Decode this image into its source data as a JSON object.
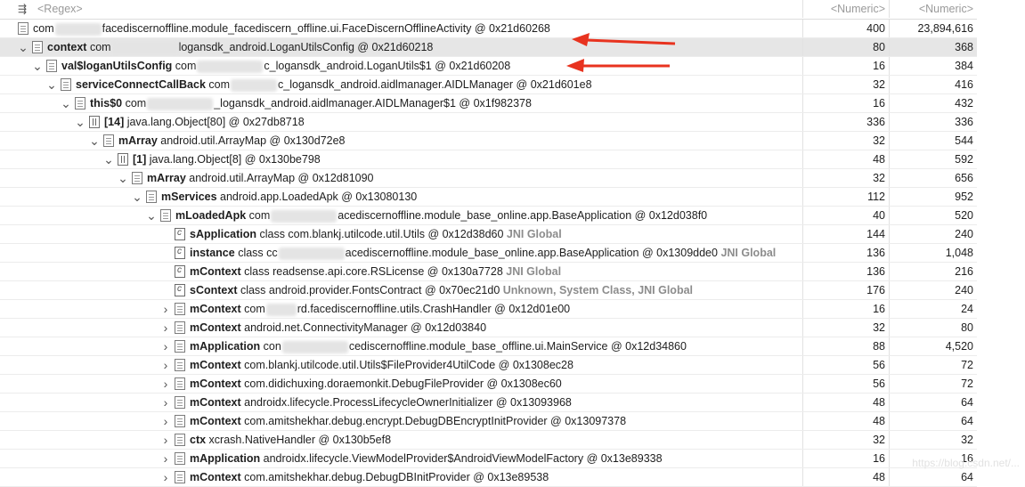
{
  "header": {
    "regex_placeholder": "<Regex>",
    "col1": "<Numeric>",
    "col2": "<Numeric>"
  },
  "rows": [
    {
      "depth": 0,
      "toggle": "",
      "icon": "obj",
      "field": "",
      "pre": "com",
      "blur": "m",
      "post": "facediscernoffline.module_facediscern_offline.ui.FaceDiscernOfflineActivity @ 0x21d60268",
      "gc": "",
      "v1": "400",
      "v2": "23,894,616"
    },
    {
      "depth": 1,
      "toggle": "v",
      "icon": "obj",
      "field": "context",
      "pre": "com",
      "blur": "l",
      "post": "logansdk_android.LoganUtilsConfig @ 0x21d60218",
      "gc": "",
      "v1": "80",
      "v2": "368",
      "selected": true
    },
    {
      "depth": 2,
      "toggle": "v",
      "icon": "obj",
      "field": "val$loganUtilsConfig",
      "pre": "com",
      "blur": "l",
      "post": "c_logansdk_android.LoganUtils$1 @ 0x21d60208",
      "gc": "",
      "v1": "16",
      "v2": "384"
    },
    {
      "depth": 3,
      "toggle": "v",
      "icon": "obj",
      "field": "serviceConnectCallBack",
      "pre": "com",
      "blur": "m",
      "post": "c_logansdk_android.aidlmanager.AIDLManager @ 0x21d601e8",
      "gc": "",
      "v1": "32",
      "v2": "416"
    },
    {
      "depth": 4,
      "toggle": "v",
      "icon": "obj",
      "field": "this$0",
      "pre": "com",
      "blur": "l",
      "post": "_logansdk_android.aidlmanager.AIDLManager$1 @ 0x1f982378",
      "gc": "",
      "v1": "16",
      "v2": "432"
    },
    {
      "depth": 5,
      "toggle": "v",
      "icon": "arr",
      "field": "[14]",
      "pre": "java.lang.Object[80] @ 0x27db8718",
      "blur": "",
      "post": "",
      "gc": "",
      "v1": "336",
      "v2": "336"
    },
    {
      "depth": 6,
      "toggle": "v",
      "icon": "obj",
      "field": "mArray",
      "pre": "android.util.ArrayMap @ 0x130d72e8",
      "blur": "",
      "post": "",
      "gc": "",
      "v1": "32",
      "v2": "544"
    },
    {
      "depth": 7,
      "toggle": "v",
      "icon": "arr",
      "field": "[1]",
      "pre": "java.lang.Object[8] @ 0x130be798",
      "blur": "",
      "post": "",
      "gc": "",
      "v1": "48",
      "v2": "592"
    },
    {
      "depth": 8,
      "toggle": "v",
      "icon": "obj",
      "field": "mArray",
      "pre": "android.util.ArrayMap @ 0x12d81090",
      "blur": "",
      "post": "",
      "gc": "",
      "v1": "32",
      "v2": "656"
    },
    {
      "depth": 9,
      "toggle": "v",
      "icon": "obj",
      "field": "mServices",
      "pre": "android.app.LoadedApk @ 0x13080130",
      "blur": "",
      "post": "",
      "gc": "",
      "v1": "112",
      "v2": "952"
    },
    {
      "depth": 10,
      "toggle": "v",
      "icon": "obj",
      "field": "mLoadedApk",
      "pre": "com",
      "blur": "l",
      "post": "acediscernoffline.module_base_online.app.BaseApplication @ 0x12d038f0",
      "gc": "",
      "v1": "40",
      "v2": "520"
    },
    {
      "depth": 11,
      "toggle": "",
      "icon": "cls",
      "field": "sApplication",
      "pre": "class com.blankj.utilcode.util.Utils @ 0x12d38d60",
      "blur": "",
      "post": "",
      "gc": "JNI Global",
      "v1": "144",
      "v2": "240"
    },
    {
      "depth": 11,
      "toggle": "",
      "icon": "cls",
      "field": "instance",
      "pre": "class cc",
      "blur": "l",
      "post": "acediscernoffline.module_base_online.app.BaseApplication @ 0x1309dde0",
      "gc": "JNI Global",
      "v1": "136",
      "v2": "1,048"
    },
    {
      "depth": 11,
      "toggle": "",
      "icon": "cls",
      "field": "mContext",
      "pre": "class readsense.api.core.RSLicense @ 0x130a7728",
      "blur": "",
      "post": "",
      "gc": "JNI Global",
      "v1": "136",
      "v2": "216"
    },
    {
      "depth": 11,
      "toggle": "",
      "icon": "cls",
      "field": "sContext",
      "pre": "class android.provider.FontsContract @ 0x70ec21d0",
      "blur": "",
      "post": "",
      "gc": "Unknown, System Class, JNI Global",
      "v1": "176",
      "v2": "240"
    },
    {
      "depth": 11,
      "toggle": ">",
      "icon": "obj",
      "field": "mContext",
      "pre": "com",
      "blur": "s",
      "post": "rd.facediscernoffline.utils.CrashHandler @ 0x12d01e00",
      "gc": "",
      "v1": "16",
      "v2": "24"
    },
    {
      "depth": 11,
      "toggle": ">",
      "icon": "obj",
      "field": "mContext",
      "pre": "android.net.ConnectivityManager @ 0x12d03840",
      "blur": "",
      "post": "",
      "gc": "",
      "v1": "32",
      "v2": "80"
    },
    {
      "depth": 11,
      "toggle": ">",
      "icon": "obj",
      "field": "mApplication",
      "pre": "con",
      "blur": "l",
      "post": "cediscernoffline.module_base_offline.ui.MainService @ 0x12d34860",
      "gc": "",
      "v1": "88",
      "v2": "4,520"
    },
    {
      "depth": 11,
      "toggle": ">",
      "icon": "obj",
      "field": "mContext",
      "pre": "com.blankj.utilcode.util.Utils$FileProvider4UtilCode @ 0x1308ec28",
      "blur": "",
      "post": "",
      "gc": "",
      "v1": "56",
      "v2": "72"
    },
    {
      "depth": 11,
      "toggle": ">",
      "icon": "obj",
      "field": "mContext",
      "pre": "com.didichuxing.doraemonkit.DebugFileProvider @ 0x1308ec60",
      "blur": "",
      "post": "",
      "gc": "",
      "v1": "56",
      "v2": "72"
    },
    {
      "depth": 11,
      "toggle": ">",
      "icon": "obj",
      "field": "mContext",
      "pre": "androidx.lifecycle.ProcessLifecycleOwnerInitializer @ 0x13093968",
      "blur": "",
      "post": "",
      "gc": "",
      "v1": "48",
      "v2": "64"
    },
    {
      "depth": 11,
      "toggle": ">",
      "icon": "obj",
      "field": "mContext",
      "pre": "com.amitshekhar.debug.encrypt.DebugDBEncryptInitProvider @ 0x13097378",
      "blur": "",
      "post": "",
      "gc": "",
      "v1": "48",
      "v2": "64"
    },
    {
      "depth": 11,
      "toggle": ">",
      "icon": "obj",
      "field": "ctx",
      "pre": "xcrash.NativeHandler @ 0x130b5ef8",
      "blur": "",
      "post": "",
      "gc": "",
      "v1": "32",
      "v2": "32"
    },
    {
      "depth": 11,
      "toggle": ">",
      "icon": "obj",
      "field": "mApplication",
      "pre": "androidx.lifecycle.ViewModelProvider$AndroidViewModelFactory @ 0x13e89338",
      "blur": "",
      "post": "",
      "gc": "",
      "v1": "16",
      "v2": "16"
    },
    {
      "depth": 11,
      "toggle": ">",
      "icon": "obj",
      "field": "mContext",
      "pre": "com.amitshekhar.debug.DebugDBInitProvider @ 0x13e89538",
      "blur": "",
      "post": "",
      "gc": "",
      "v1": "48",
      "v2": "64"
    }
  ],
  "watermark": "https://blog.csdn.net/..."
}
